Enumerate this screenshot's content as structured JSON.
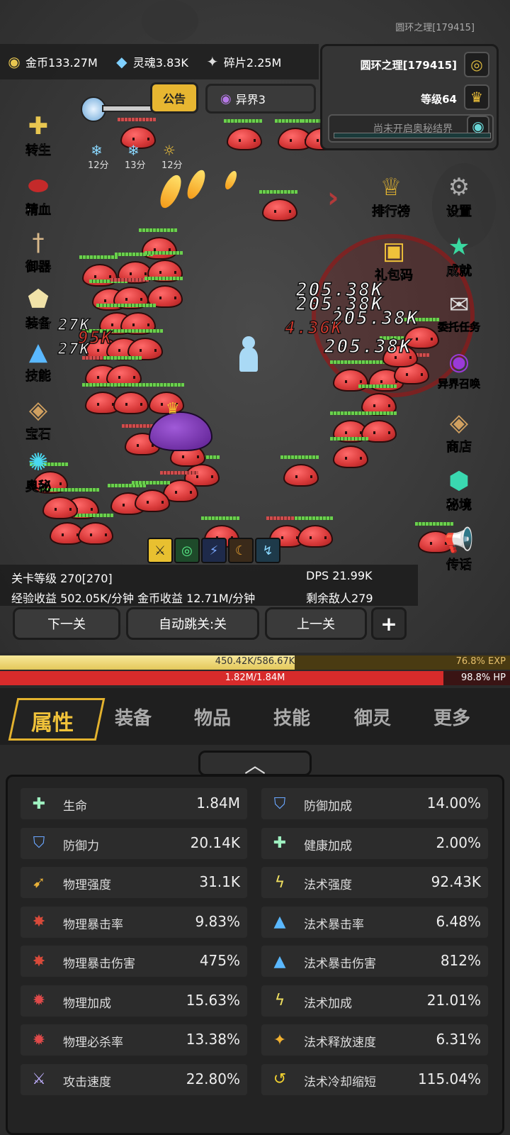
{
  "header": {
    "server_title": "圆环之理[179415]"
  },
  "resources": [
    {
      "icon": "gold-coin-icon",
      "label": "金币133.27M"
    },
    {
      "icon": "soul-icon",
      "label": "灵魂3.83K"
    },
    {
      "icon": "fragment-icon",
      "label": "碎片2.25M"
    }
  ],
  "info_panel": {
    "player_name": "圆环之理[179415]",
    "level": "等级64",
    "realm_status": "尚未开启奥秘结界"
  },
  "notice_label": "公告",
  "realm_tab_label": "异界3",
  "timers": [
    "12分",
    "13分",
    "12分"
  ],
  "left_menu": [
    "转生",
    "精血",
    "御器",
    "装备",
    "技能",
    "宝石",
    "奥秘"
  ],
  "right_menu": [
    "排行榜",
    "设置",
    "礼包码",
    "成就",
    "委托任务",
    "异界召唤",
    "商店",
    "秘境",
    "传话"
  ],
  "damage_numbers": [
    "205.38K",
    "205.38K",
    "205.38K",
    "205.38K",
    "27K",
    "27K",
    "95K",
    "4.36K"
  ],
  "game_info": {
    "stage_level": "关卡等级 270[270]",
    "dps": "DPS 21.99K",
    "income": "经验收益 502.05K/分钟 金币收益 12.71M/分钟",
    "enemies_left": "剩余敌人279"
  },
  "nav": {
    "next": "下一关",
    "auto": "自动跳关:关",
    "prev": "上一关",
    "plus": "+"
  },
  "exp": {
    "text": "450.42K/586.67K",
    "pct": "76.8% EXP",
    "fraction": 0.768
  },
  "hp": {
    "text": "1.82M/1.84M",
    "pct": "98.8%  HP",
    "fraction": 0.988
  },
  "tabs": [
    "属性",
    "装备",
    "物品",
    "技能",
    "御灵",
    "更多"
  ],
  "stats_left": [
    {
      "icon": "health-cross-icon",
      "name": "生命",
      "value": "1.84M"
    },
    {
      "icon": "shield-icon",
      "name": "防御力",
      "value": "20.14K"
    },
    {
      "icon": "physical-power-icon",
      "name": "物理强度",
      "value": "31.1K"
    },
    {
      "icon": "physical-crit-icon",
      "name": "物理暴击率",
      "value": "9.83%"
    },
    {
      "icon": "physical-crit-damage-icon",
      "name": "物理暴击伤害",
      "value": "475%"
    },
    {
      "icon": "physical-bonus-icon",
      "name": "物理加成",
      "value": "15.63%"
    },
    {
      "icon": "physical-kill-icon",
      "name": "物理必杀率",
      "value": "13.38%"
    },
    {
      "icon": "attack-speed-icon",
      "name": "攻击速度",
      "value": "22.80%"
    }
  ],
  "stats_right": [
    {
      "icon": "defense-bonus-icon",
      "name": "防御加成",
      "value": "14.00%"
    },
    {
      "icon": "health-bonus-icon",
      "name": "健康加成",
      "value": "2.00%"
    },
    {
      "icon": "spell-power-icon",
      "name": "法术强度",
      "value": "92.43K"
    },
    {
      "icon": "spell-crit-icon",
      "name": "法术暴击率",
      "value": "6.48%"
    },
    {
      "icon": "spell-crit-damage-icon",
      "name": "法术暴击伤害",
      "value": "812%"
    },
    {
      "icon": "spell-bonus-icon",
      "name": "法术加成",
      "value": "21.01%"
    },
    {
      "icon": "cast-speed-icon",
      "name": "法术释放速度",
      "value": "6.31%"
    },
    {
      "icon": "cooldown-icon",
      "name": "法术冷却缩短",
      "value": "115.04%"
    }
  ]
}
